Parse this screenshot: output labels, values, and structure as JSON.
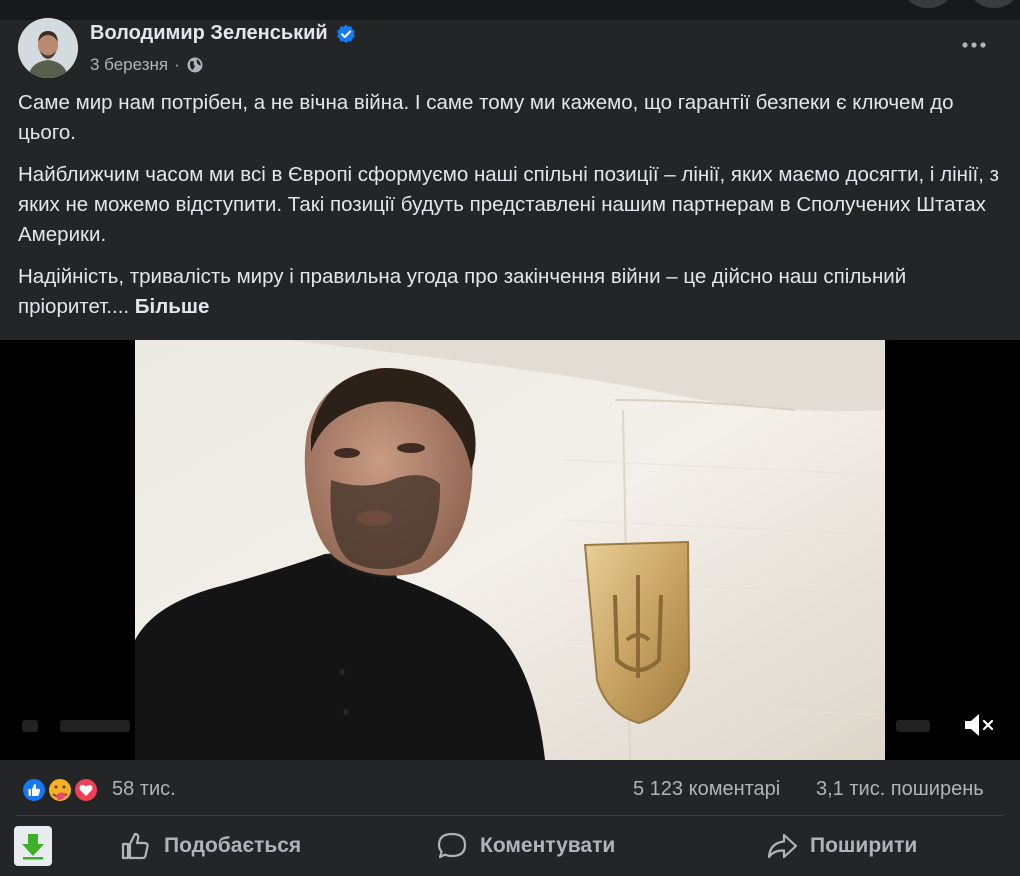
{
  "post": {
    "author": "Володимир Зеленський",
    "date": "3 березня",
    "separator": "·",
    "paragraphs": [
      "Саме мир нам потрібен, а не вічна війна. І саме тому ми кажемо, що гарантії безпеки є ключем до цього.",
      "Найближчим часом ми всі в Європі сформуємо наші спільні позиції – лінії, яких маємо досягти, і лінії, з яких не можемо відступити. Такі позиції будуть представлені нашим партнерам в Сполучених Штатах Америки.",
      "Надійність, тривалість миру і правильна угода про закінчення війни – це дійсно наш спільний пріоритет...."
    ],
    "see_more": "Більше"
  },
  "stats": {
    "reactions_count": "58 тис.",
    "comments": "5 123 коментарі",
    "shares": "3,1 тис. поширень"
  },
  "actions": {
    "like": "Подобається",
    "comment": "Коментувати",
    "share": "Поширити"
  },
  "colors": {
    "background": "#242526",
    "text": "#e4e6eb",
    "secondary": "#b0b3b8",
    "verified": "#1877f2"
  },
  "icons": [
    "verified-badge-icon",
    "globe-icon",
    "more-options-icon",
    "mute-icon",
    "like-reaction-icon",
    "care-reaction-icon",
    "love-reaction-icon",
    "thumb-up-icon",
    "comment-icon",
    "share-icon",
    "download-icon"
  ]
}
